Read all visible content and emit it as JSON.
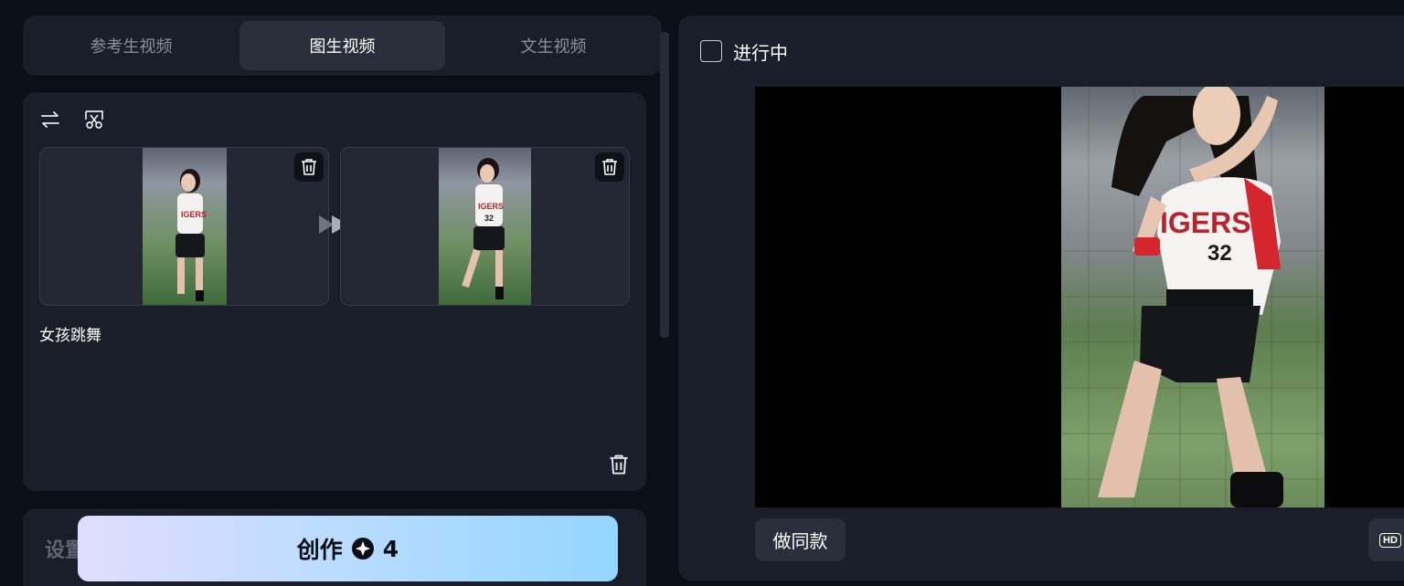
{
  "tabs": [
    {
      "label": "参考生视频",
      "active": false
    },
    {
      "label": "图生视频",
      "active": true
    },
    {
      "label": "文生视频",
      "active": false
    }
  ],
  "editor": {
    "tool_icons": [
      "swap-icon",
      "crop-scissors-icon"
    ],
    "image_cards": [
      {
        "name": "start-frame",
        "delete_icon": "trash-icon"
      },
      {
        "name": "end-frame",
        "delete_icon": "trash-icon"
      }
    ],
    "transition_icon": "double-play-arrow-icon",
    "prompt": "女孩跳舞",
    "clear_icon": "trash-icon"
  },
  "settings": {
    "label": "设置"
  },
  "create_button": {
    "label": "创作",
    "cost_icon": "credit-coin-icon",
    "cost": "4"
  },
  "result": {
    "status_label": "进行中",
    "status_checked": false,
    "make_same_label": "做同款",
    "hd_label": "HD"
  },
  "colors": {
    "background": "#0b0f17",
    "panel": "#1a1e28",
    "active_tab": "#2a2f3b",
    "create_gradient_start": "#e1dcff",
    "create_gradient_end": "#93d5ff"
  }
}
